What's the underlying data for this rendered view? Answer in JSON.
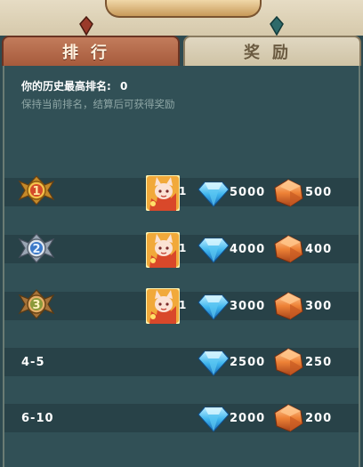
{
  "tabs": [
    {
      "label": "排行",
      "selected": false
    },
    {
      "label": "奖励",
      "selected": true
    }
  ],
  "history": {
    "label": "你的历史最高排名:",
    "value": "0"
  },
  "hint": "保持当前排名，结算后可获得奖励",
  "rewards": [
    {
      "rank_icon": "gold-medal-1",
      "medal_number": "1",
      "item_count": "1",
      "diamonds": "5000",
      "crystals": "500"
    },
    {
      "rank_icon": "silver-medal-2",
      "medal_number": "2",
      "item_count": "1",
      "diamonds": "4000",
      "crystals": "400"
    },
    {
      "rank_icon": "bronze-medal-3",
      "medal_number": "3",
      "item_count": "1",
      "diamonds": "3000",
      "crystals": "300"
    },
    {
      "rank_label": "4-5",
      "diamonds": "2500",
      "crystals": "250"
    },
    {
      "rank_label": "6-10",
      "diamonds": "2000",
      "crystals": "200"
    }
  ],
  "colors": {
    "panel": "#315056",
    "row": "#284248",
    "tab_active": "#e0d7c1",
    "tab_inactive": "#b06545",
    "diamond": "#3fb6ee",
    "crystal": "#ee8236"
  }
}
